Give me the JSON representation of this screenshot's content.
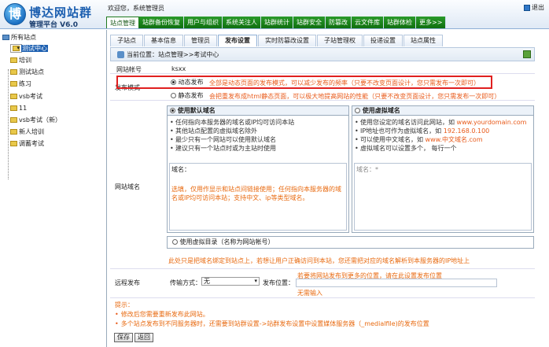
{
  "header": {
    "logo_mark": "博",
    "logo_title": "博达网站群",
    "logo_sub": "管理平台  V6.0",
    "welcome": "欢迎您，系统管理员",
    "logout": "退出",
    "menu": [
      "站点管理",
      "站群备份恢复",
      "用户与组织",
      "系统关注人",
      "站群统计",
      "站群安全",
      "防篡改",
      "云文件库",
      "站群体检",
      "更多>>"
    ]
  },
  "sidebar": {
    "root": "所有站点",
    "items": [
      "测试中心",
      "培训",
      "测试站点",
      "练习",
      "vsb考试",
      "11",
      "vsb考试（新）",
      "新人培训",
      "调蓄考试"
    ]
  },
  "tabs": [
    "子站点",
    "基本信息",
    "管理员",
    "发布设置",
    "实时防篡改设置",
    "子站管理权",
    "投递设置",
    "站点属性"
  ],
  "breadcrumb": "当前位置：站点管理>>考试中心",
  "form": {
    "account_label": "网站帐号",
    "account_value": "ksxx",
    "publish_mode_label": "发布模式",
    "dynamic_label": "动态发布",
    "dynamic_desc": "全部是动态页面的发布模式，可以减少发布的频率（只要不改变页面设计，您只需发布一次即可）",
    "static_label": "静态发布",
    "static_desc": "会把重发布成html静态页面，可以极大地提高网站的性能（只要不改变页面设计，您只需发布一次即可）",
    "domain_label": "网站域名",
    "default_domain_title": "使用默认域名",
    "default_domain_items": [
      "任何指向本服务器的域名或IP均可访问本站",
      "其他站点配置的虚拟域名除外",
      "最少只有一个网站可以使用默认域名",
      "建议只有一个站点时或为主站时使用"
    ],
    "domain_field_label": "域名：",
    "domain_note": "选填，仅用作显示和站点间链接使用；任何指向本服务器的域名或IP均可访问本站；支持中文、ip等类型域名。",
    "virtual_domain_title": "使用虚拟域名",
    "virtual_domain_items": [
      "使用您设定的域名访问此网站，如 ",
      "IP地址也可作为虚拟域名，如 ",
      "可以使用中文域名，如 ",
      "虚拟域名可以设置多个，   每行一个"
    ],
    "virtual_domain_hl": [
      "www.yourdomain.com",
      "192.168.0.100",
      "www.中文域名.com",
      ""
    ],
    "virtual_field_label": "域名：*",
    "virtual_dir_title": "使用虚拟目录（名称为网站帐号）",
    "domain_footer": "此处只是把域名绑定到站点上，若想让用户正确访问到本站，您还需把对应的域名解析到本服务器的IP地址上",
    "remote_label": "远程发布",
    "transfer_label": "传输方式：",
    "transfer_value": "无",
    "position_label": "发布位置：",
    "remote_hint": "若要将网站发布到更多的位置，请在此设置发布位置",
    "no_input": "无需输入"
  },
  "tips": {
    "title": "提示：",
    "items": [
      "修改后您需要重新发布此网站。",
      "多个站点发布到不同服务器时，还需要到站群设置->站群发布设置中设置媒体服务器（_medialfile)的发布位置"
    ]
  },
  "buttons": {
    "save": "保存",
    "back": "返回"
  }
}
